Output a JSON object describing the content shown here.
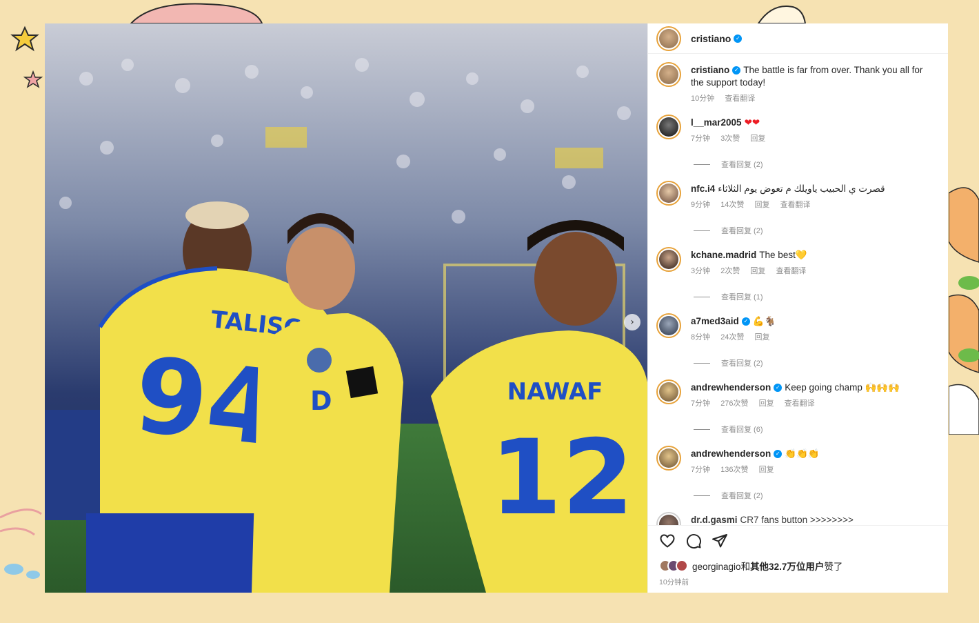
{
  "post": {
    "author": "cristiano",
    "photo_jerseys": [
      {
        "name": "TALISCA",
        "number": "94"
      },
      {
        "name": "NAWAF",
        "number": "12"
      }
    ],
    "photo_chest_letter": "D"
  },
  "caption": {
    "user": "cristiano",
    "text": "The battle is far from over. Thank you all for the support today!",
    "time": "10分钟",
    "translate": "查看翻译"
  },
  "comments": [
    {
      "user": "l__mar2005",
      "verified": false,
      "text": "❤❤",
      "time": "7分钟",
      "likes": "3次赞",
      "reply": "回复",
      "translate": "",
      "view_replies": "查看回复 (2)"
    },
    {
      "user": "nfc.i4",
      "verified": false,
      "text": "قصرت ي الحبيب ياويلك م تعوض يوم الثلاثاء",
      "time": "9分钟",
      "likes": "14次赞",
      "reply": "回复",
      "translate": "查看翻译",
      "view_replies": "查看回复 (2)"
    },
    {
      "user": "kchane.madrid",
      "verified": false,
      "text": "The best💛",
      "time": "3分钟",
      "likes": "2次赞",
      "reply": "回复",
      "translate": "查看翻译",
      "view_replies": "查看回复 (1)"
    },
    {
      "user": "a7med3aid",
      "verified": true,
      "text": "💪🐐",
      "time": "8分钟",
      "likes": "24次赞",
      "reply": "回复",
      "translate": "",
      "view_replies": "查看回复 (2)"
    },
    {
      "user": "andrewhenderson",
      "verified": true,
      "text": "Keep going champ 🙌🙌🙌",
      "time": "7分钟",
      "likes": "276次赞",
      "reply": "回复",
      "translate": "查看翻译",
      "view_replies": "查看回复 (6)"
    },
    {
      "user": "andrewhenderson",
      "verified": true,
      "text": "👏👏👏",
      "time": "7分钟",
      "likes": "136次赞",
      "reply": "回复",
      "translate": "",
      "view_replies": "查看回复 (2)"
    },
    {
      "user": "dr.d.gasmi",
      "verified": false,
      "text": "CR7 fans button >>>>>>>>",
      "time": "",
      "likes": "",
      "reply": "",
      "translate": "",
      "view_replies": ""
    }
  ],
  "footer": {
    "liked_by_user": "georginagio",
    "liked_by_and": "和",
    "liked_by_others": "其他32.7万位用户",
    "liked_suffix": "赞了",
    "time": "10分钟前"
  },
  "icons": [
    "heart-icon",
    "comment-icon",
    "share-icon",
    "verified-badge-icon",
    "chevron-right-icon"
  ],
  "colors": {
    "background": "#f6e2b2",
    "verified": "#0095f6",
    "jersey_yellow": "#f2e04a",
    "jersey_blue": "#1f4fc4"
  }
}
